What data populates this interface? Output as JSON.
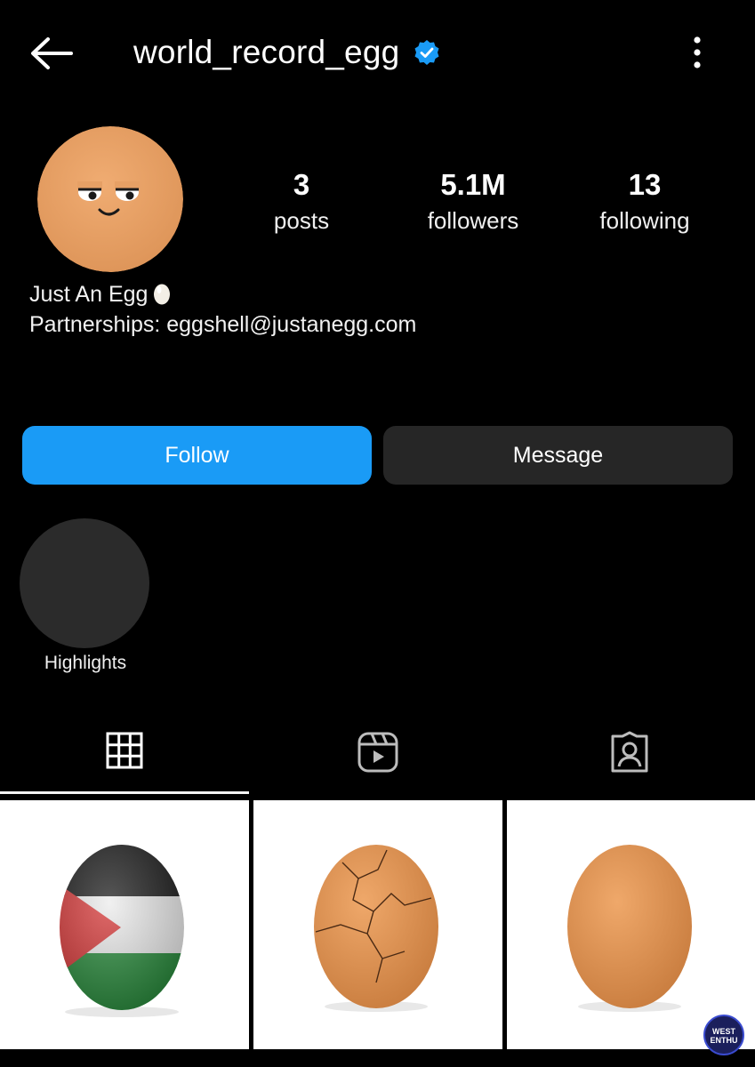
{
  "header": {
    "username": "world_record_egg",
    "verified": true,
    "back_icon": "arrow-left-icon",
    "more_icon": "more-vertical-icon"
  },
  "stats": {
    "posts": {
      "value": "3",
      "label": "posts"
    },
    "followers": {
      "value": "5.1M",
      "label": "followers"
    },
    "following": {
      "value": "13",
      "label": "following"
    }
  },
  "bio": {
    "name": "Just An Egg",
    "partnerships": "Partnerships: eggshell@justanegg.com"
  },
  "actions": {
    "follow_label": "Follow",
    "message_label": "Message"
  },
  "highlights": [
    {
      "label": "Highlights"
    }
  ],
  "tabs": [
    {
      "icon": "grid-icon",
      "active": true
    },
    {
      "icon": "reels-icon",
      "active": false
    },
    {
      "icon": "tagged-icon",
      "active": false
    }
  ],
  "posts": [
    {
      "image": "egg-palestine-flag"
    },
    {
      "image": "egg-cracked"
    },
    {
      "image": "egg-plain"
    }
  ],
  "watermark": {
    "line1": "WEST",
    "line2": "ENTHU"
  },
  "colors": {
    "background": "#000000",
    "follow_button": "#1a9bf6",
    "message_button": "#262626",
    "verified_badge": "#1a9bf6",
    "egg": "#e8a46a"
  }
}
